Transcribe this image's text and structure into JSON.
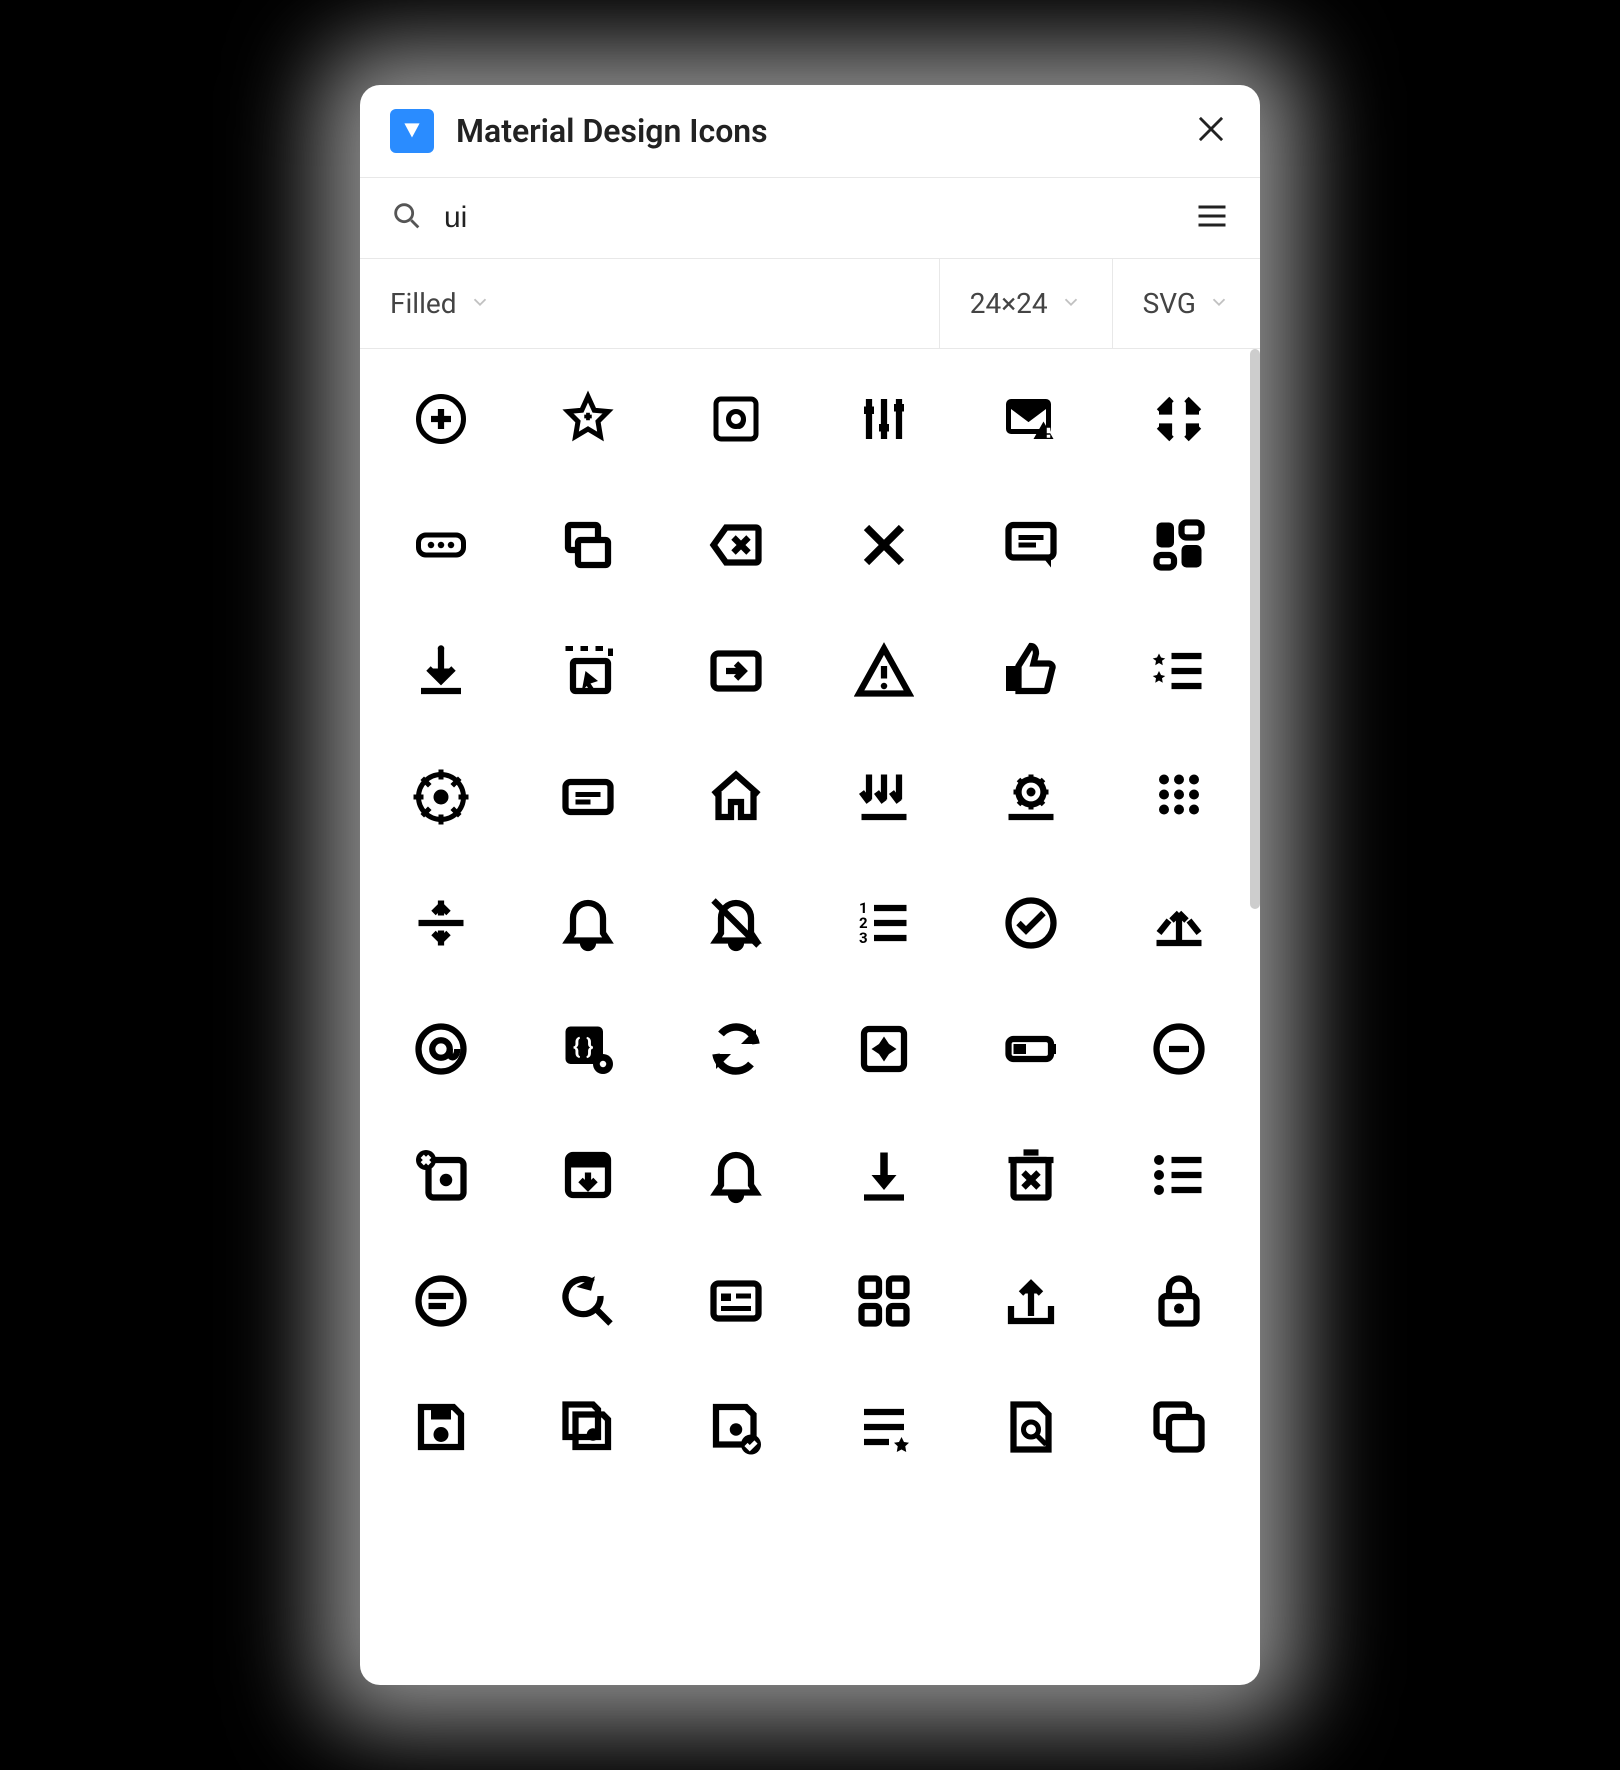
{
  "header": {
    "title": "Material Design Icons"
  },
  "search": {
    "value": "ui",
    "placeholder": "Search"
  },
  "filters": {
    "style": "Filled",
    "size": "24×24",
    "format": "SVG"
  },
  "icons": [
    {
      "name": "add-circle-outline"
    },
    {
      "name": "star-outline"
    },
    {
      "name": "turned-in-at"
    },
    {
      "name": "tune"
    },
    {
      "name": "mail-error"
    },
    {
      "name": "fullscreen-exit"
    },
    {
      "name": "more-horiz-box"
    },
    {
      "name": "copy-overlap"
    },
    {
      "name": "backspace-outline"
    },
    {
      "name": "close"
    },
    {
      "name": "comment"
    },
    {
      "name": "dashboard"
    },
    {
      "name": "download"
    },
    {
      "name": "select-icon"
    },
    {
      "name": "input-box"
    },
    {
      "name": "warning-outline"
    },
    {
      "name": "thumb-up"
    },
    {
      "name": "format-list-star"
    },
    {
      "name": "settings-alt"
    },
    {
      "name": "label-box"
    },
    {
      "name": "home"
    },
    {
      "name": "download-multi"
    },
    {
      "name": "settings-tray"
    },
    {
      "name": "dialpad"
    },
    {
      "name": "split-horizontal"
    },
    {
      "name": "notifications-outline"
    },
    {
      "name": "notifications-off"
    },
    {
      "name": "format-list-numbered"
    },
    {
      "name": "check-circle-outline"
    },
    {
      "name": "upload-split"
    },
    {
      "name": "at-sign"
    },
    {
      "name": "code-settings"
    },
    {
      "name": "refresh"
    },
    {
      "name": "brightness-box"
    },
    {
      "name": "battery-low"
    },
    {
      "name": "remove-circle-outline"
    },
    {
      "name": "phonelink-erase"
    },
    {
      "name": "archive-down"
    },
    {
      "name": "notifications"
    },
    {
      "name": "download-arrow"
    },
    {
      "name": "delete-box"
    },
    {
      "name": "list"
    },
    {
      "name": "equalizer-circle"
    },
    {
      "name": "search-redo"
    },
    {
      "name": "card-details"
    },
    {
      "name": "apps"
    },
    {
      "name": "upload"
    },
    {
      "name": "lock"
    },
    {
      "name": "save"
    },
    {
      "name": "save-copy"
    },
    {
      "name": "save-check"
    },
    {
      "name": "list-star"
    },
    {
      "name": "find-in-page"
    },
    {
      "name": "copy"
    }
  ]
}
